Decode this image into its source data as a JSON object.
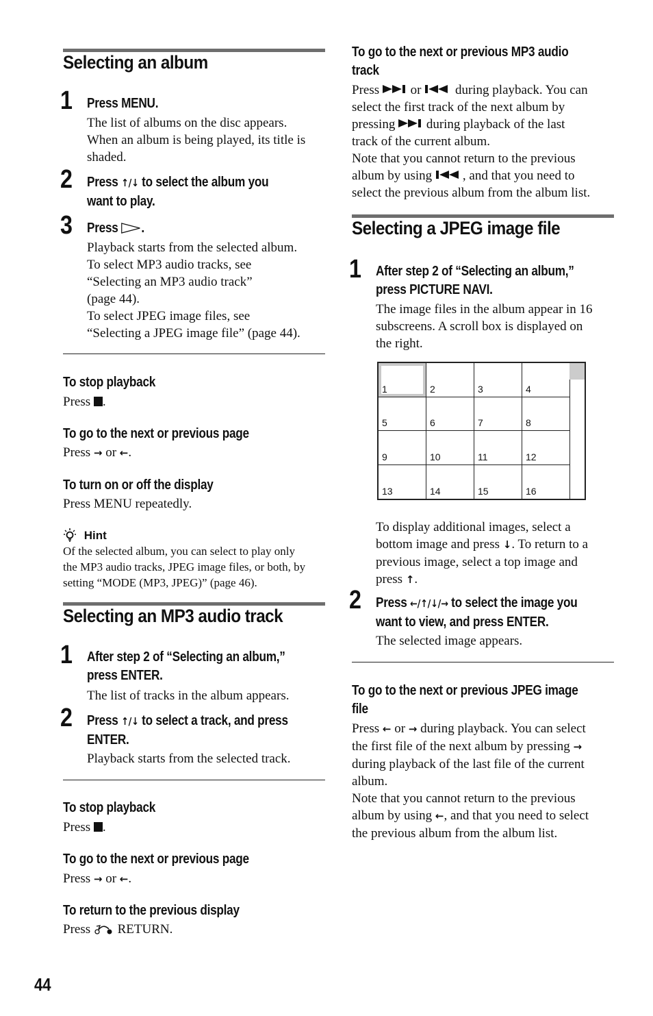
{
  "page_number": "44",
  "left": {
    "album": {
      "title": "Selecting an album",
      "steps": [
        {
          "num": "1",
          "head": "Press MENU.",
          "body": [
            "The list of albums on the disc appears.",
            "When an album is being played, its title is",
            "shaded."
          ]
        },
        {
          "num": "2",
          "head_parts": [
            "Press ",
            "↑/↓",
            " to select the album you"
          ],
          "head_line2": "want to play."
        },
        {
          "num": "3",
          "head_prefix": "Press ",
          "head_icon": "play-icon",
          "head_suffix": ".",
          "body": [
            "Playback starts from the selected album.",
            "To select MP3 audio tracks, see",
            "“Selecting an MP3 audio track”",
            "(page 44).",
            "To select JPEG image files, see",
            "“Selecting a JPEG image file” (page 44)."
          ]
        }
      ],
      "tips": [
        {
          "head": "To stop playback",
          "body_prefix": "Press ",
          "icon": "stop-icon",
          "body_suffix": "."
        },
        {
          "head": "To go to the next or previous page",
          "body_prefix": "Press ",
          "arrow1": "→",
          "mid": " or ",
          "arrow2": "←",
          "body_suffix": "."
        },
        {
          "head": "To turn on or off the display",
          "body": "Press MENU repeatedly."
        }
      ],
      "hint": {
        "label": "Hint",
        "icon": "lightbulb-icon",
        "body": [
          "Of the selected album, you can select to play only",
          "the MP3 audio tracks, JPEG image files, or both, by",
          "setting “MODE (MP3, JPEG)” (page 46)."
        ]
      }
    },
    "mp3": {
      "title": "Selecting an MP3 audio track",
      "steps": [
        {
          "num": "1",
          "head": [
            "After step 2 of “Selecting an album,”",
            "press ENTER."
          ],
          "body": "The list of tracks in the album appears."
        },
        {
          "num": "2",
          "head_parts": [
            "Press ",
            "↑/↓",
            " to select a track, and press"
          ],
          "head_line2": "ENTER.",
          "body": "Playback starts from the selected track."
        }
      ],
      "tips": [
        {
          "head": "To stop playback",
          "body_prefix": "Press ",
          "icon": "stop-icon",
          "body_suffix": "."
        },
        {
          "head": "To go to the next or previous page",
          "body_prefix": "Press ",
          "arrow1": "→",
          "mid": " or ",
          "arrow2": "←",
          "body_suffix": "."
        },
        {
          "head": "To return to the previous display",
          "body_prefix": "Press ",
          "icon": "return-icon",
          "body_suffix": " RETURN."
        }
      ]
    }
  },
  "right": {
    "mp3_nav": {
      "head": [
        "To go to the next or previous MP3 audio",
        "track"
      ],
      "body": {
        "l1a": "Press ",
        "l1b": " or ",
        "l1c": " during playback. You can",
        "l2": "select the first track of the next album by",
        "l3a": "pressing ",
        "l3b": " during playback of the last",
        "l4": "track of the current album.",
        "l5": "Note that you cannot return to the previous",
        "l6a": "album by using ",
        "l6b": ", and that you need to",
        "l7": "select the previous album from the album list."
      }
    },
    "jpeg": {
      "title": "Selecting a JPEG image file",
      "step1": {
        "num": "1",
        "head": [
          "After step 2 of “Selecting an album,”",
          "press PICTURE NAVI."
        ],
        "body": [
          "The image files in the album appear in 16",
          "subscreens. A scroll box is displayed on",
          "the right."
        ]
      },
      "grid": {
        "cells": [
          "1",
          "2",
          "3",
          "4",
          "5",
          "6",
          "7",
          "8",
          "9",
          "10",
          "11",
          "12",
          "13",
          "14",
          "15",
          "16"
        ],
        "selected_index": 0,
        "scroll_position": 0
      },
      "after_grid": {
        "l1": "To display additional images, select a",
        "l2a": "bottom image and press ",
        "l2arrow": "↓",
        "l2b": ". To return to a",
        "l3": "previous image, select a top image and",
        "l4a": "press ",
        "l4arrow": "↑",
        "l4b": "."
      },
      "step2": {
        "num": "2",
        "head_a": "Press ",
        "head_arrows": "←/↑/↓/→",
        "head_b": " to select the image you",
        "head_line2": "want to view, and press ENTER.",
        "body": "The selected image appears."
      },
      "nav": {
        "head": [
          "To go to the next or previous JPEG image",
          "file"
        ],
        "l1a": "Press ",
        "l1arrow1": "←",
        "l1mid": " or ",
        "l1arrow2": "→",
        "l1b": " during playback. You can select",
        "l2a": "the first file of the next album by pressing ",
        "l2arrow": "→",
        "l3": "during playback of the last file of the current",
        "l4": "album.",
        "l5": "Note that you cannot return to the previous",
        "l6a": "album by using ",
        "l6arrow": "←",
        "l6b": ", and that you need to select",
        "l7": "the previous album from the album list."
      }
    }
  }
}
